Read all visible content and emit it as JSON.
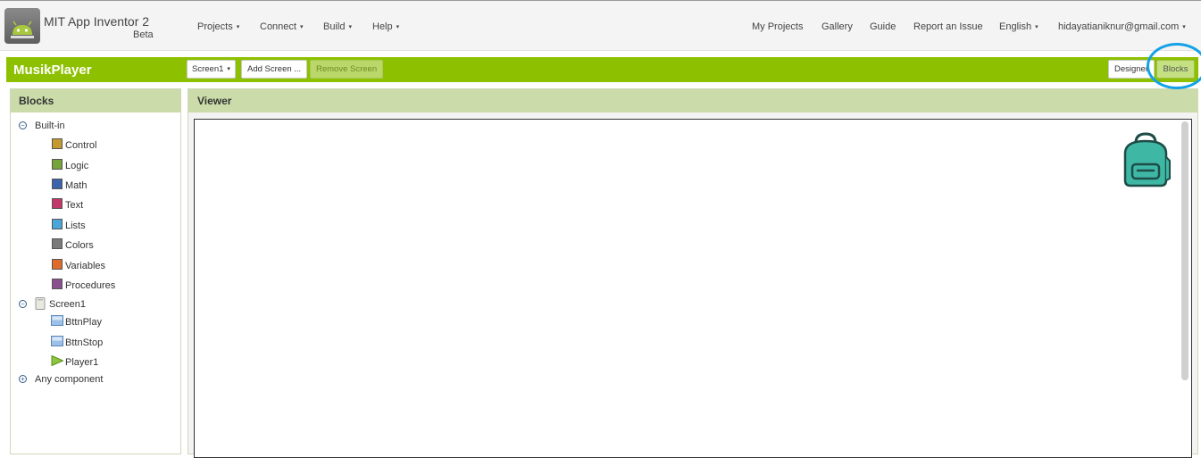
{
  "app": {
    "title": "MIT App Inventor 2",
    "subtitle": "Beta"
  },
  "menus": {
    "left": [
      {
        "label": "Projects",
        "has_caret": true
      },
      {
        "label": "Connect",
        "has_caret": true
      },
      {
        "label": "Build",
        "has_caret": true
      },
      {
        "label": "Help",
        "has_caret": true
      }
    ],
    "right": [
      {
        "label": "My Projects"
      },
      {
        "label": "Gallery"
      },
      {
        "label": "Guide"
      },
      {
        "label": "Report an Issue"
      },
      {
        "label": "English",
        "has_caret": true
      },
      {
        "label": "hidayatianiknur@gmail.com",
        "has_caret": true
      }
    ],
    "caret_glyph": "▾"
  },
  "project": {
    "name": "MusikPlayer",
    "screen_select": "Screen1",
    "add_screen_label": "Add Screen ...",
    "remove_screen_label": "Remove Screen",
    "designer_label": "Designer",
    "blocks_label": "Blocks"
  },
  "blocks_panel": {
    "title": "Blocks",
    "builtin": {
      "label": "Built-in",
      "items": [
        {
          "label": "Control",
          "color": "#c49a2e"
        },
        {
          "label": "Logic",
          "color": "#76a33a"
        },
        {
          "label": "Math",
          "color": "#3b64ad"
        },
        {
          "label": "Text",
          "color": "#c4376b"
        },
        {
          "label": "Lists",
          "color": "#4aa6d8"
        },
        {
          "label": "Colors",
          "color": "#7a7a7a"
        },
        {
          "label": "Variables",
          "color": "#e0692c"
        },
        {
          "label": "Procedures",
          "color": "#8a4f8e"
        }
      ]
    },
    "screen": {
      "label": "Screen1",
      "components": [
        {
          "label": "BttnPlay",
          "icon": "button-icon"
        },
        {
          "label": "BttnStop",
          "icon": "button-icon"
        },
        {
          "label": "Player1",
          "icon": "player-icon"
        }
      ]
    },
    "any_component": "Any component"
  },
  "viewer": {
    "title": "Viewer"
  },
  "colors": {
    "accent_green": "#8dc100",
    "panel_header": "#cbdcaa",
    "highlight_ring": "#14a2e6",
    "backpack": "#3fb7a5"
  }
}
